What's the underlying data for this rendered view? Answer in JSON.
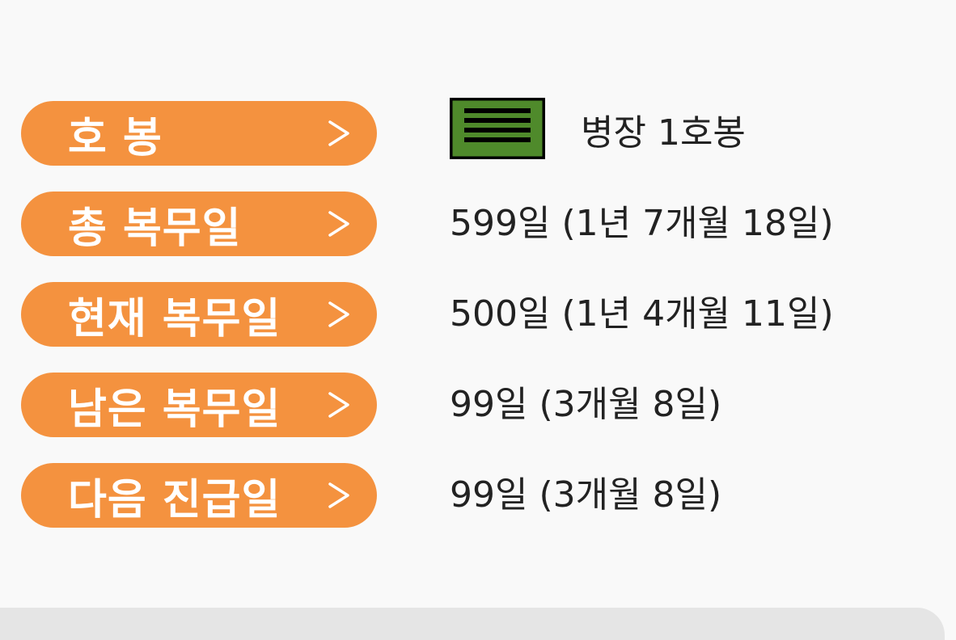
{
  "rows": [
    {
      "label": "호 봉",
      "value": "병장 1호봉"
    },
    {
      "label": "총 복무일",
      "value": "599일 (1년 7개월 18일)"
    },
    {
      "label": "현재 복무일",
      "value": "500일 (1년 4개월 11일)"
    },
    {
      "label": "남은 복무일",
      "value": "99일 (3개월 8일)"
    },
    {
      "label": "다음 진급일",
      "value": "99일 (3개월 8일)"
    }
  ],
  "icons": {
    "chevron": "chevron-right-icon",
    "rank": "sergeant-rank-insignia-icon"
  },
  "colors": {
    "accent": "#f4923f",
    "rank_green": "#4f8a2b",
    "text": "#222222",
    "background": "#f9f9f9"
  }
}
